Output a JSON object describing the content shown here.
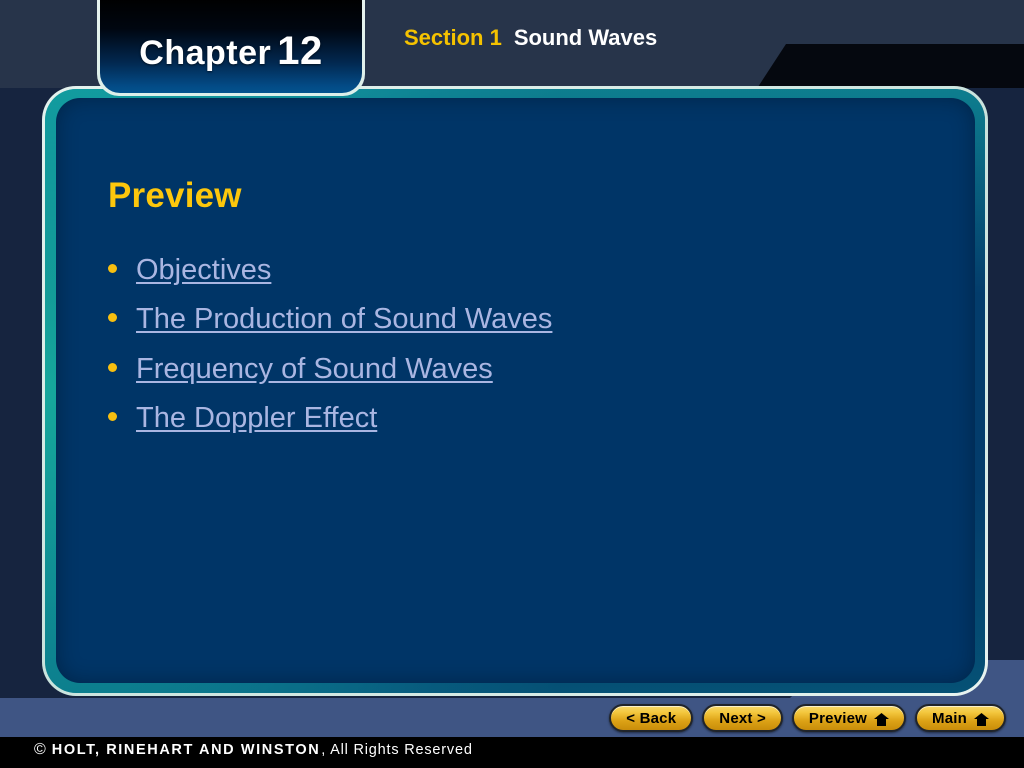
{
  "chapter_tab": {
    "label": "Chapter",
    "number": "12"
  },
  "header": {
    "section_label": "Section 1",
    "section_title": "Sound Waves"
  },
  "slide": {
    "title": "Preview",
    "links": [
      {
        "label": "Objectives"
      },
      {
        "label": "The Production of Sound Waves"
      },
      {
        "label": "Frequency of Sound Waves"
      },
      {
        "label": "The Doppler Effect"
      }
    ]
  },
  "nav": {
    "back_label": "< Back",
    "next_label": "Next >",
    "preview_label": "Preview",
    "main_label": "Main"
  },
  "footer": {
    "copyright_symbol": "©",
    "brand": "HOLT, RINEHART AND WINSTON",
    "rights": ", All Rights Reserved"
  },
  "colors": {
    "accent_gold": "#fdc70c",
    "section_label_gold": "#f5c200",
    "link_lavender": "#aab6e2",
    "panel_navy": "#003567",
    "panel_border_teal": "#16a79c",
    "nav_band_slate": "#3f5584",
    "header_slate": "#27344a",
    "button_gold": "#f3c63c"
  }
}
